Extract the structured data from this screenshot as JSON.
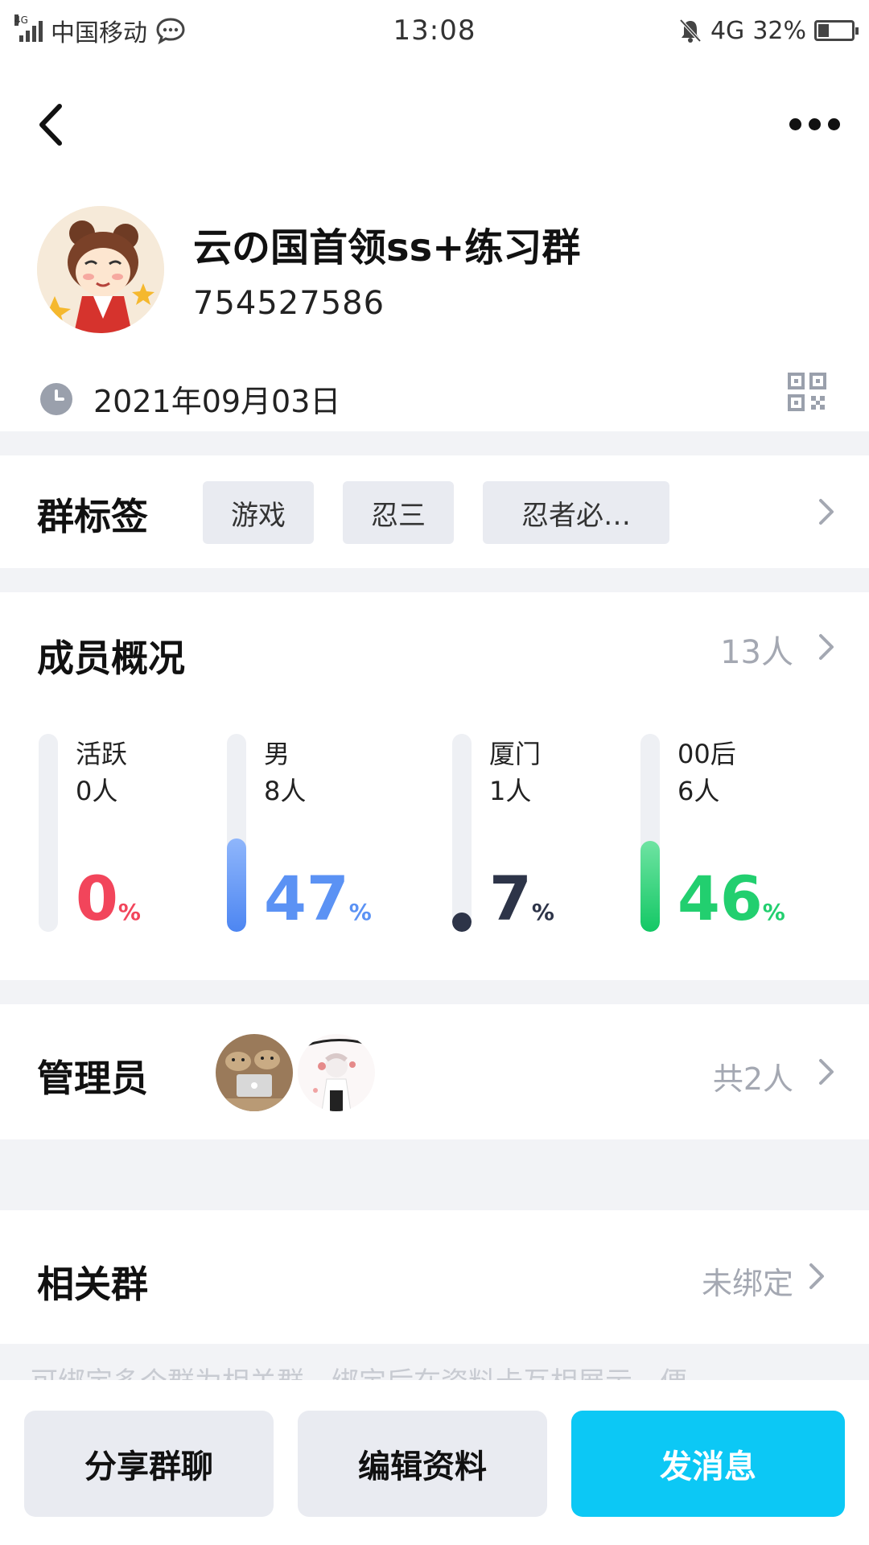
{
  "status_bar": {
    "network_tag": "4G",
    "carrier": "中国移动",
    "time": "13:08",
    "network": "4G",
    "battery": "32%",
    "battery_level": 0.32
  },
  "group": {
    "name": "云の国首领ss+练习群",
    "id": "754527586",
    "created_date": "2021年09月03日"
  },
  "tags_section": {
    "title": "群标签",
    "tags": [
      "游戏",
      "忍三",
      "忍者必…"
    ]
  },
  "members_section": {
    "title": "成员概况",
    "count": "13人",
    "stats": [
      {
        "label": "活跃",
        "count": "0人",
        "percent": "0",
        "unit": "%",
        "value": 0.0,
        "color": "#f2455b"
      },
      {
        "label": "男",
        "count": "8人",
        "percent": "47",
        "unit": "%",
        "value": 0.47,
        "color": "#5b92f4"
      },
      {
        "label": "厦门",
        "count": "1人",
        "percent": "7",
        "unit": "%",
        "value": 0.07,
        "color": "#2d3448"
      },
      {
        "label": "00后",
        "count": "6人",
        "percent": "46",
        "unit": "%",
        "value": 0.46,
        "color": "#22cf6f"
      }
    ]
  },
  "admins_section": {
    "title": "管理员",
    "count": "共2人"
  },
  "related_section": {
    "title": "相关群",
    "value": "未绑定",
    "hint": "可绑定多个群为相关群，绑定后在资料卡互相展示，便"
  },
  "actions": {
    "share": "分享群聊",
    "edit": "编辑资料",
    "send": "发消息"
  }
}
